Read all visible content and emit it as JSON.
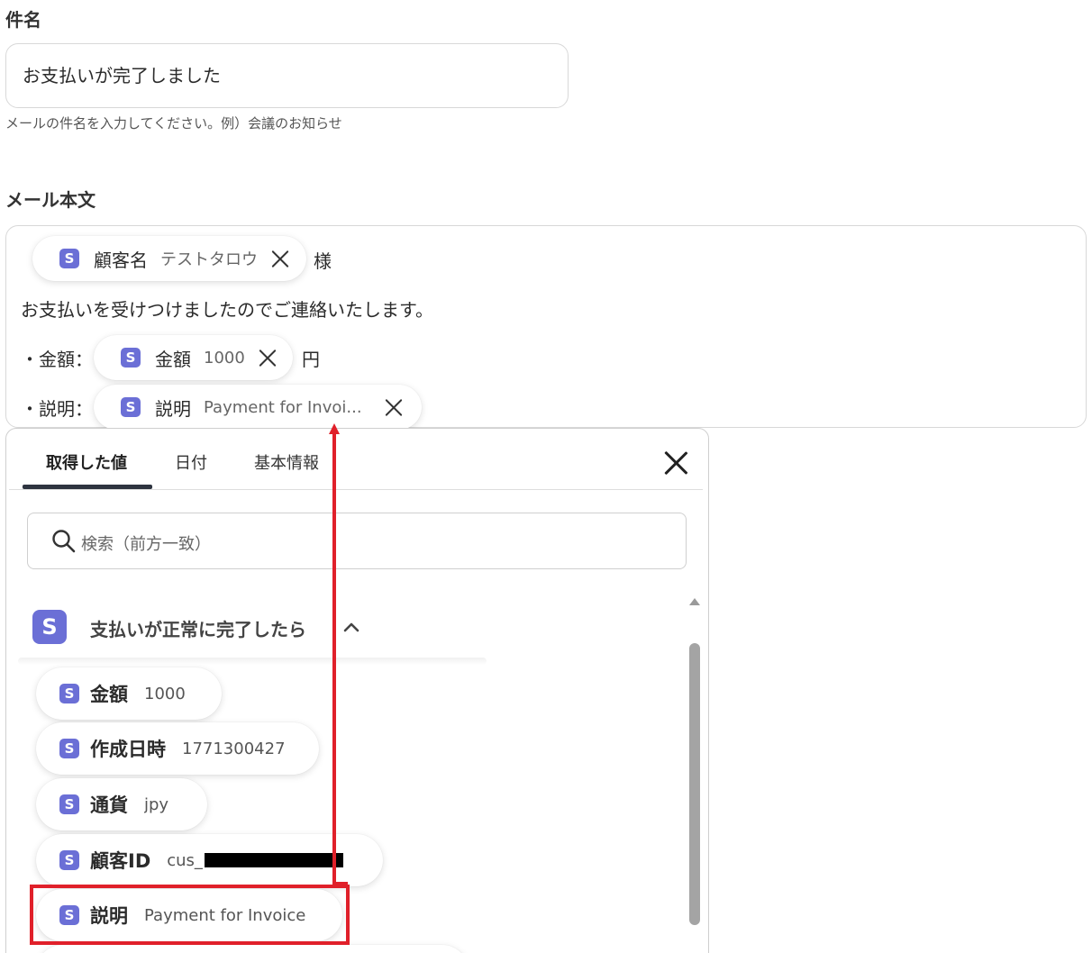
{
  "subject": {
    "label": "件名",
    "value": "お支払いが完了しました",
    "hint": "メールの件名を入力してください。例）会議のお知らせ"
  },
  "mail_body": {
    "label": "メール本文",
    "line1_chip": {
      "badge": "S",
      "label": "顧客名",
      "value": "テストタロウ"
    },
    "line1_suffix": "様",
    "line2": "お支払いを受けつけましたのでご連絡いたします。",
    "amount_prefix": "・金額：",
    "amount_chip": {
      "badge": "S",
      "label": "金額",
      "value": "1000"
    },
    "amount_suffix": "円",
    "desc_prefix": "・説明：",
    "desc_chip": {
      "badge": "S",
      "label": "説明",
      "value": "Payment for Invoi..."
    }
  },
  "panel": {
    "tabs": [
      {
        "label": "取得した値",
        "active": true
      },
      {
        "label": "日付",
        "active": false
      },
      {
        "label": "基本情報",
        "active": false
      }
    ],
    "search_placeholder": "検索（前方一致）",
    "section": {
      "badge": "S",
      "title": "支払いが正常に完了したら"
    },
    "items": [
      {
        "badge": "S",
        "label": "金額",
        "value": "1000"
      },
      {
        "badge": "S",
        "label": "作成日時",
        "value": "1771300427"
      },
      {
        "badge": "S",
        "label": "通貨",
        "value": "jpy"
      },
      {
        "badge": "S",
        "label": "顧客ID",
        "value": "cus_"
      },
      {
        "badge": "S",
        "label": "説明",
        "value": "Payment for Invoice"
      }
    ]
  },
  "colors": {
    "accent": "#6b6fd6",
    "highlight": "#e0202a"
  }
}
